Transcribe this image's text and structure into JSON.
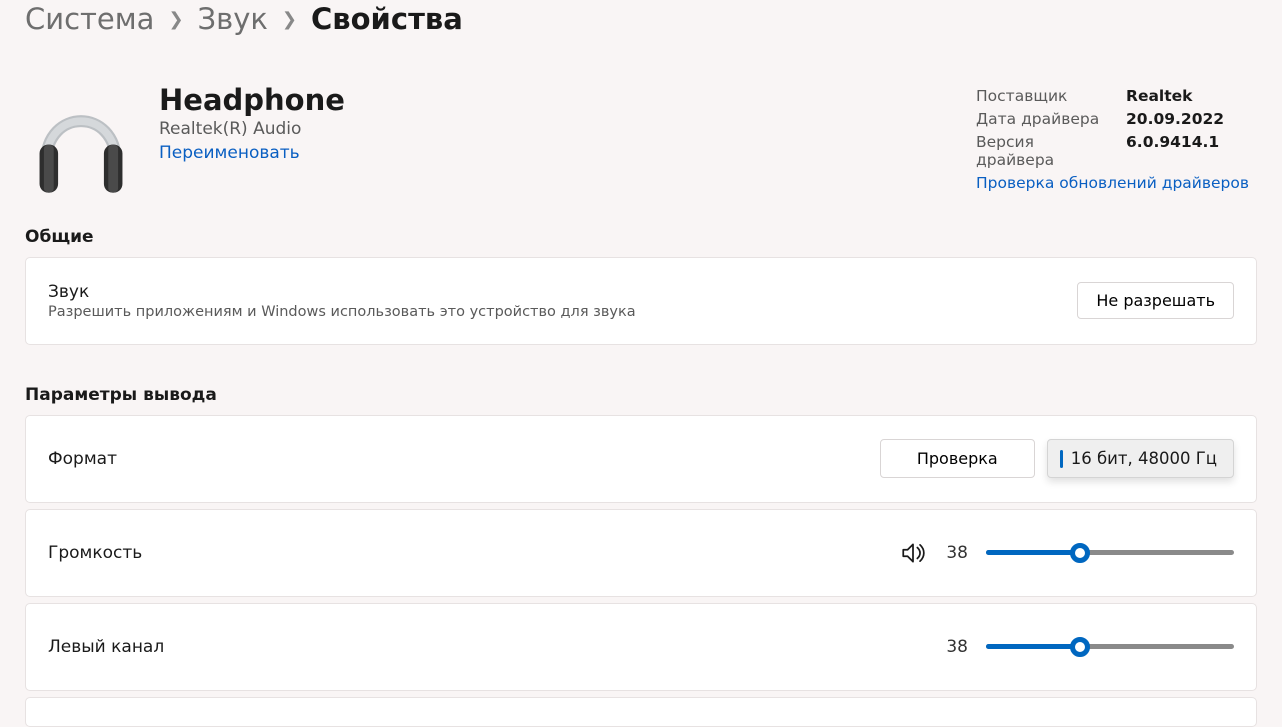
{
  "breadcrumb": {
    "sys": "Система",
    "sound": "Звук",
    "current": "Свойства"
  },
  "device": {
    "name": "Headphone",
    "sub": "Realtek(R) Audio",
    "rename": "Переименовать"
  },
  "infoLabels": {
    "vendor": "Поставщик",
    "date": "Дата драйвера",
    "version": "Версия драйвера"
  },
  "info": {
    "vendor": "Realtek",
    "date": "20.09.2022",
    "version": "6.0.9414.1",
    "update": "Проверка обновлений драйверов"
  },
  "sections": {
    "general": "Общие",
    "output": "Параметры вывода"
  },
  "general": {
    "title": "Звук",
    "desc": "Разрешить приложениям и Windows использовать это устройство для звука",
    "btn": "Не разрешать"
  },
  "format": {
    "label": "Формат",
    "test": "Проверка",
    "value": "16 бит, 48000 Гц"
  },
  "volume": {
    "label": "Громкость",
    "value": "38",
    "percent": 38
  },
  "left": {
    "label": "Левый канал",
    "value": "38",
    "percent": 38
  }
}
